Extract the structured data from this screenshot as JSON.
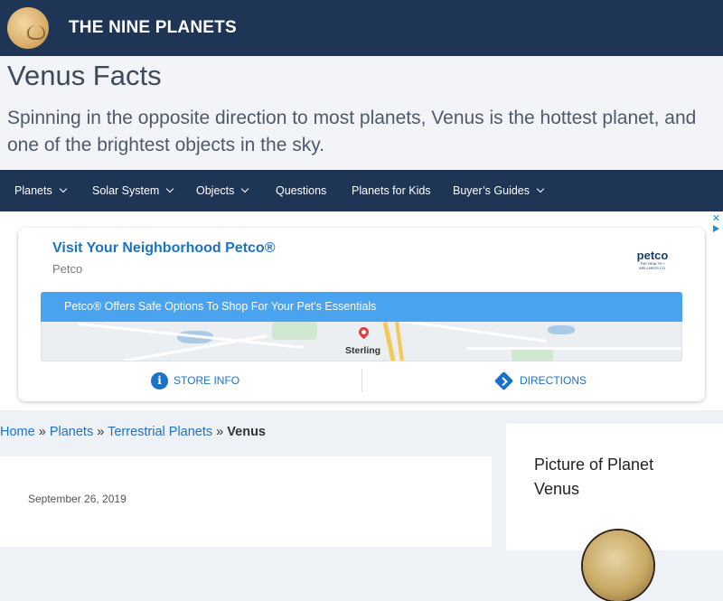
{
  "header": {
    "site_title": "THE NINE PLANETS",
    "logo_icon": "planet-logo-icon",
    "background_color": "#1f3556"
  },
  "hero": {
    "title": "Venus Facts",
    "subtitle": "Spinning in the opposite direction to most planets, Venus is the hottest planet, and one of the brightest objects in the sky."
  },
  "nav": {
    "items": [
      {
        "label": "Planets",
        "has_dropdown": true
      },
      {
        "label": "Solar System",
        "has_dropdown": true
      },
      {
        "label": "Objects",
        "has_dropdown": true
      },
      {
        "label": "Questions",
        "has_dropdown": false
      },
      {
        "label": "Planets for Kids",
        "has_dropdown": false
      },
      {
        "label": "Buyer’s Guides",
        "has_dropdown": true
      }
    ]
  },
  "ad": {
    "title": "Visit Your Neighborhood Petco®",
    "advertiser": "Petco",
    "logo_text": "petco",
    "logo_tagline": "THE HEALTH + WELLNESS CO.",
    "banner_text": "Petco® Offers Safe Options To Shop For Your Pet's Essentials",
    "map_label": "Sterling",
    "store_info_label": "STORE INFO",
    "directions_label": "DIRECTIONS",
    "adchoices_icon": "adchoices-icon",
    "accent_color": "#4aa3ef",
    "link_color": "#1a73c7"
  },
  "breadcrumb": {
    "items": [
      "Home",
      "Planets",
      "Terrestrial Planets"
    ],
    "separator": "»",
    "current": "Venus"
  },
  "article": {
    "date": "September 26, 2019"
  },
  "sidebar": {
    "widget_title": "Picture of Planet Venus"
  }
}
